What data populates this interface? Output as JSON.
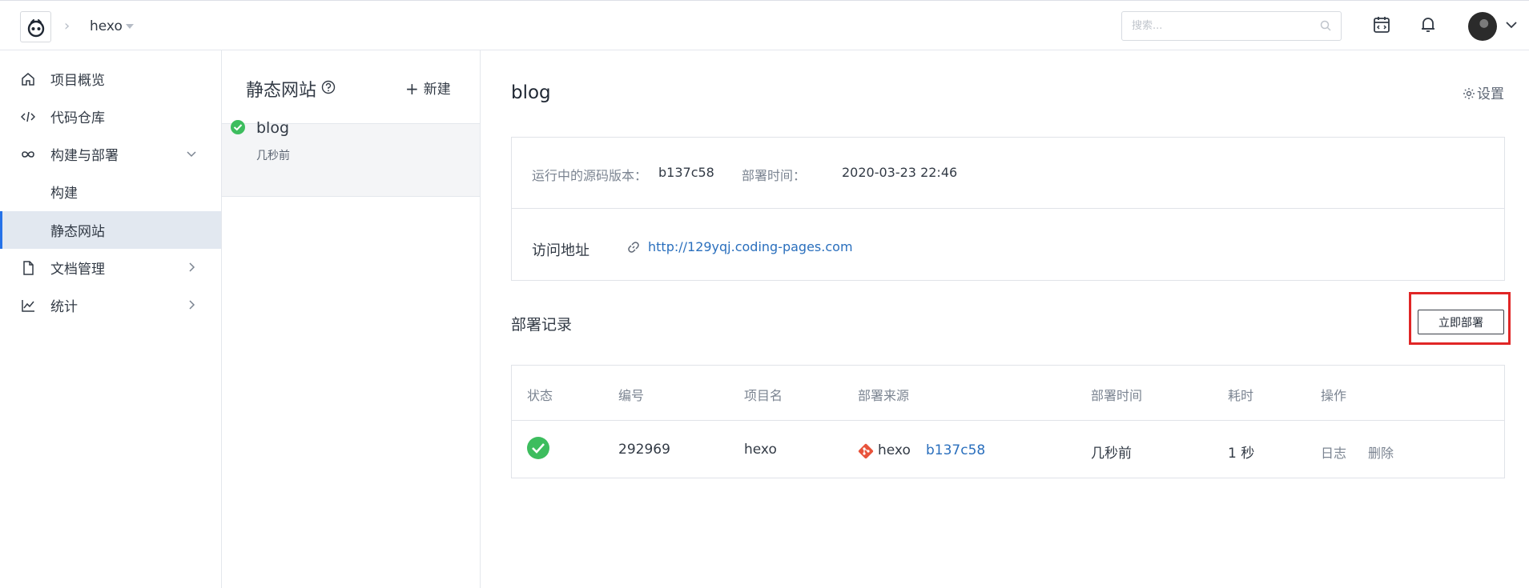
{
  "header": {
    "project": "hexo",
    "search": {
      "placeholder": "搜索..."
    }
  },
  "sidebar": {
    "items": [
      {
        "label": "项目概览",
        "icon": "home-icon"
      },
      {
        "label": "代码仓库",
        "icon": "code-icon"
      },
      {
        "label": "构建与部署",
        "icon": "infinity-icon",
        "expanded": true
      },
      {
        "label": "构建"
      },
      {
        "label": "静态网站",
        "active": true
      },
      {
        "label": "文档管理",
        "icon": "document-icon"
      },
      {
        "label": "统计",
        "icon": "chart-icon"
      }
    ]
  },
  "sites": {
    "title": "静态网站",
    "new_label": "新建",
    "items": [
      {
        "name": "blog",
        "time": "几秒前",
        "status": "success"
      }
    ]
  },
  "detail": {
    "title": "blog",
    "settings_label": "设置",
    "version_label": "运行中的源码版本：",
    "version_value": "b137c58",
    "deploy_time_label": "部署时间：",
    "deploy_time_value": "2020-03-23 22:46",
    "address_label": "访问地址",
    "address_url": "http://129yqj.coding-pages.com"
  },
  "records": {
    "title": "部署记录",
    "deploy_button": "立即部署",
    "columns": [
      "状态",
      "编号",
      "项目名",
      "部署来源",
      "部署时间",
      "耗时",
      "操作"
    ],
    "rows": [
      {
        "status": "success",
        "id": "292969",
        "project": "hexo",
        "source_project": "hexo",
        "source_commit": "b137c58",
        "time": "几秒前",
        "duration": "1 秒",
        "actions": [
          "日志",
          "删除"
        ]
      }
    ]
  },
  "colors": {
    "accent": "#2672e8",
    "link": "#2a6fbd",
    "success": "#3dbd5e",
    "highlight_frame": "#e02626",
    "git": "#e8533b"
  }
}
